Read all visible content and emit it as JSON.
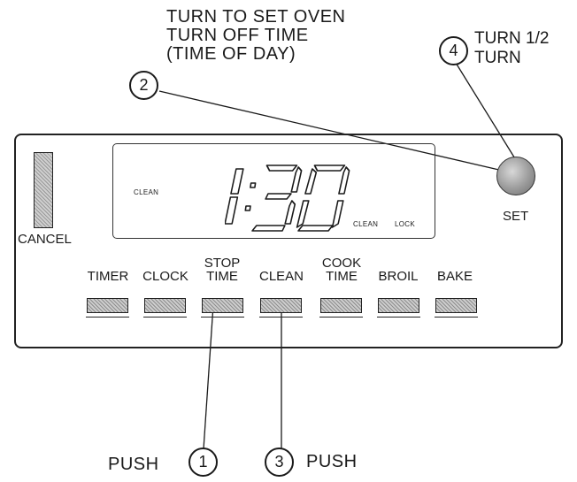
{
  "callouts": {
    "set_oven_lines": [
      "TURN TO SET OVEN",
      "TURN OFF TIME",
      "(TIME OF DAY)"
    ],
    "turn_half_lines": [
      "TURN 1/2",
      "TURN"
    ],
    "push_left": "PUSH",
    "push_right": "PUSH"
  },
  "steps": [
    "1",
    "2",
    "3",
    "4"
  ],
  "display": {
    "time": "1:30",
    "indicator_left": "CLEAN",
    "indicator_clean": "CLEAN",
    "indicator_lock": "LOCK"
  },
  "controls": {
    "cancel_label": "CANCEL",
    "set_label": "SET",
    "buttons": [
      {
        "label": "TIMER"
      },
      {
        "label": "CLOCK"
      },
      {
        "label": "STOP\nTIME"
      },
      {
        "label": "CLEAN"
      },
      {
        "label": "COOK\nTIME"
      },
      {
        "label": "BROIL"
      },
      {
        "label": "BAKE"
      }
    ]
  }
}
